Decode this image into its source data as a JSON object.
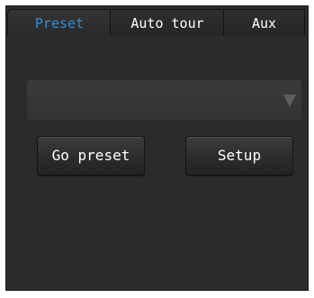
{
  "tabs": {
    "preset_label": "Preset",
    "auto_tour_label": "Auto tour",
    "aux_label": "Aux",
    "active": "preset"
  },
  "preset": {
    "select_value": "",
    "go_preset_label": "Go preset",
    "setup_label": "Setup"
  },
  "colors": {
    "panel_bg": "#2b2b2b",
    "active_tab_text": "#2f8fdc",
    "text": "#ffffff"
  }
}
